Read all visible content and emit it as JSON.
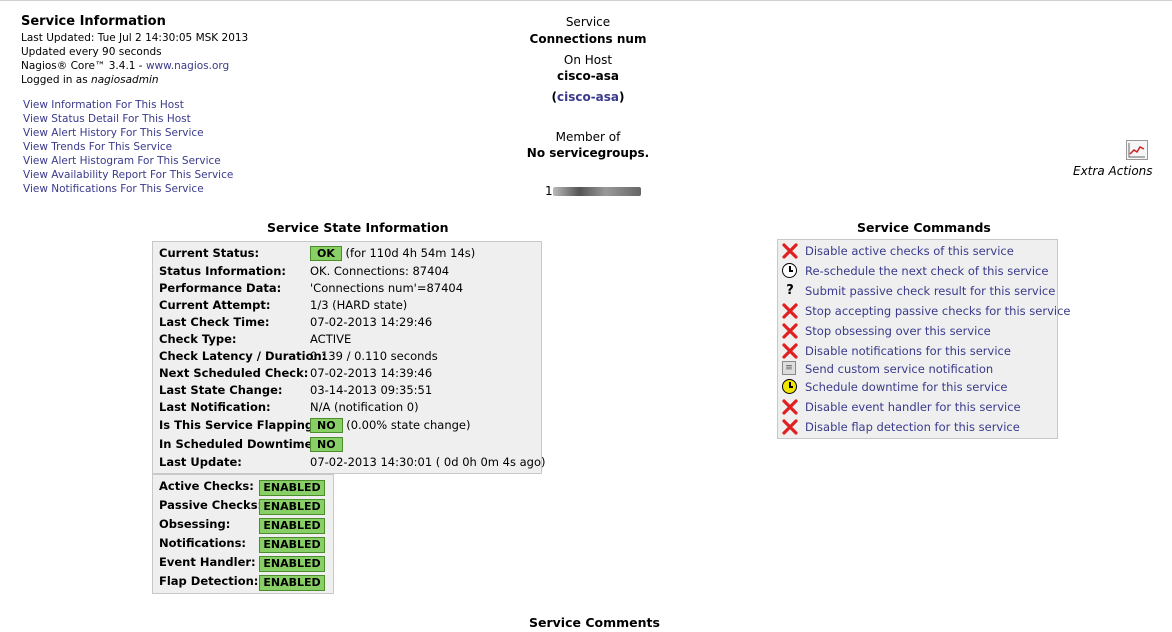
{
  "info": {
    "title": "Service Information",
    "last_updated": "Last Updated: Tue Jul 2 14:30:05 MSK 2013",
    "update_freq": "Updated every 90 seconds",
    "version_prefix": "Nagios® Core™ 3.4.1 - ",
    "version_link": "www.nagios.org",
    "logged_prefix": "Logged in as ",
    "logged_user": "nagiosadmin"
  },
  "links": [
    "View Information For This Host",
    "View Status Detail For This Host",
    "View Alert History For This Service",
    "View Trends For This Service",
    "View Alert Histogram For This Service",
    "View Availability Report For This Service",
    "View Notifications For This Service"
  ],
  "header": {
    "service_label": "Service",
    "service_name": "Connections num",
    "on_host_label": "On Host",
    "host_name": "cisco-asa",
    "host_link_open": "(",
    "host_link": "cisco-asa",
    "host_link_close": ")",
    "member_label": "Member of",
    "member_value": "No servicegroups.",
    "address_visible": "1"
  },
  "extra_actions": {
    "label": "Extra Actions",
    "icon": "graph-icon"
  },
  "state": {
    "title": "Service State Information",
    "rows": [
      {
        "label": "Current Status:",
        "badge": "OK",
        "value": "(for 110d 4h 54m 14s)"
      },
      {
        "label": "Status Information:",
        "value": "OK. Connections: 87404"
      },
      {
        "label": "Performance Data:",
        "value": "'Connections num'=87404"
      },
      {
        "label": "Current Attempt:",
        "value": "1/3  (HARD state)"
      },
      {
        "label": "Last Check Time:",
        "value": "07-02-2013 14:29:46"
      },
      {
        "label": "Check Type:",
        "value": "ACTIVE"
      },
      {
        "label": "Check Latency / Duration:",
        "value": "0.139 / 0.110 seconds"
      },
      {
        "label": "Next Scheduled Check:",
        "value": "07-02-2013 14:39:46"
      },
      {
        "label": "Last State Change:",
        "value": "03-14-2013 09:35:51"
      },
      {
        "label": "Last Notification:",
        "value": "N/A (notification 0)"
      },
      {
        "label": "Is This Service Flapping?",
        "badge": "NO",
        "value": "(0.00% state change)"
      },
      {
        "label": "In Scheduled Downtime?",
        "badge": "NO",
        "value": ""
      },
      {
        "label": "Last Update:",
        "value": "07-02-2013 14:30:01  ( 0d 0h 0m 4s ago)"
      }
    ]
  },
  "enabled": [
    {
      "label": "Active Checks:",
      "badge": "ENABLED"
    },
    {
      "label": "Passive Checks:",
      "badge": "ENABLED"
    },
    {
      "label": "Obsessing:",
      "badge": "ENABLED"
    },
    {
      "label": "Notifications:",
      "badge": "ENABLED"
    },
    {
      "label": "Event Handler:",
      "badge": "ENABLED"
    },
    {
      "label": "Flap Detection:",
      "badge": "ENABLED"
    }
  ],
  "commands": {
    "title": "Service Commands",
    "items": [
      {
        "icon": "disabled-x-icon",
        "label": "Disable active checks of this service"
      },
      {
        "icon": "clock-icon",
        "label": "Re-schedule the next check of this service"
      },
      {
        "icon": "question-icon",
        "label": "Submit passive check result for this service"
      },
      {
        "icon": "disabled-x-icon",
        "label": "Stop accepting passive checks for this service"
      },
      {
        "icon": "disabled-x-icon",
        "label": "Stop obsessing over this service"
      },
      {
        "icon": "disabled-x-icon",
        "label": "Disable notifications for this service"
      },
      {
        "icon": "notification-icon",
        "label": "Send custom service notification"
      },
      {
        "icon": "downtime-clock-icon",
        "label": "Schedule downtime for this service"
      },
      {
        "icon": "disabled-x-icon",
        "label": "Disable event handler for this service"
      },
      {
        "icon": "disabled-x-icon",
        "label": "Disable flap detection for this service"
      }
    ]
  },
  "comments": {
    "title": "Service Comments"
  },
  "colors": {
    "ok_green": "#88d066",
    "link_blue": "#3a3a8c",
    "box_gray": "#efefef",
    "x_red": "#e02020"
  }
}
